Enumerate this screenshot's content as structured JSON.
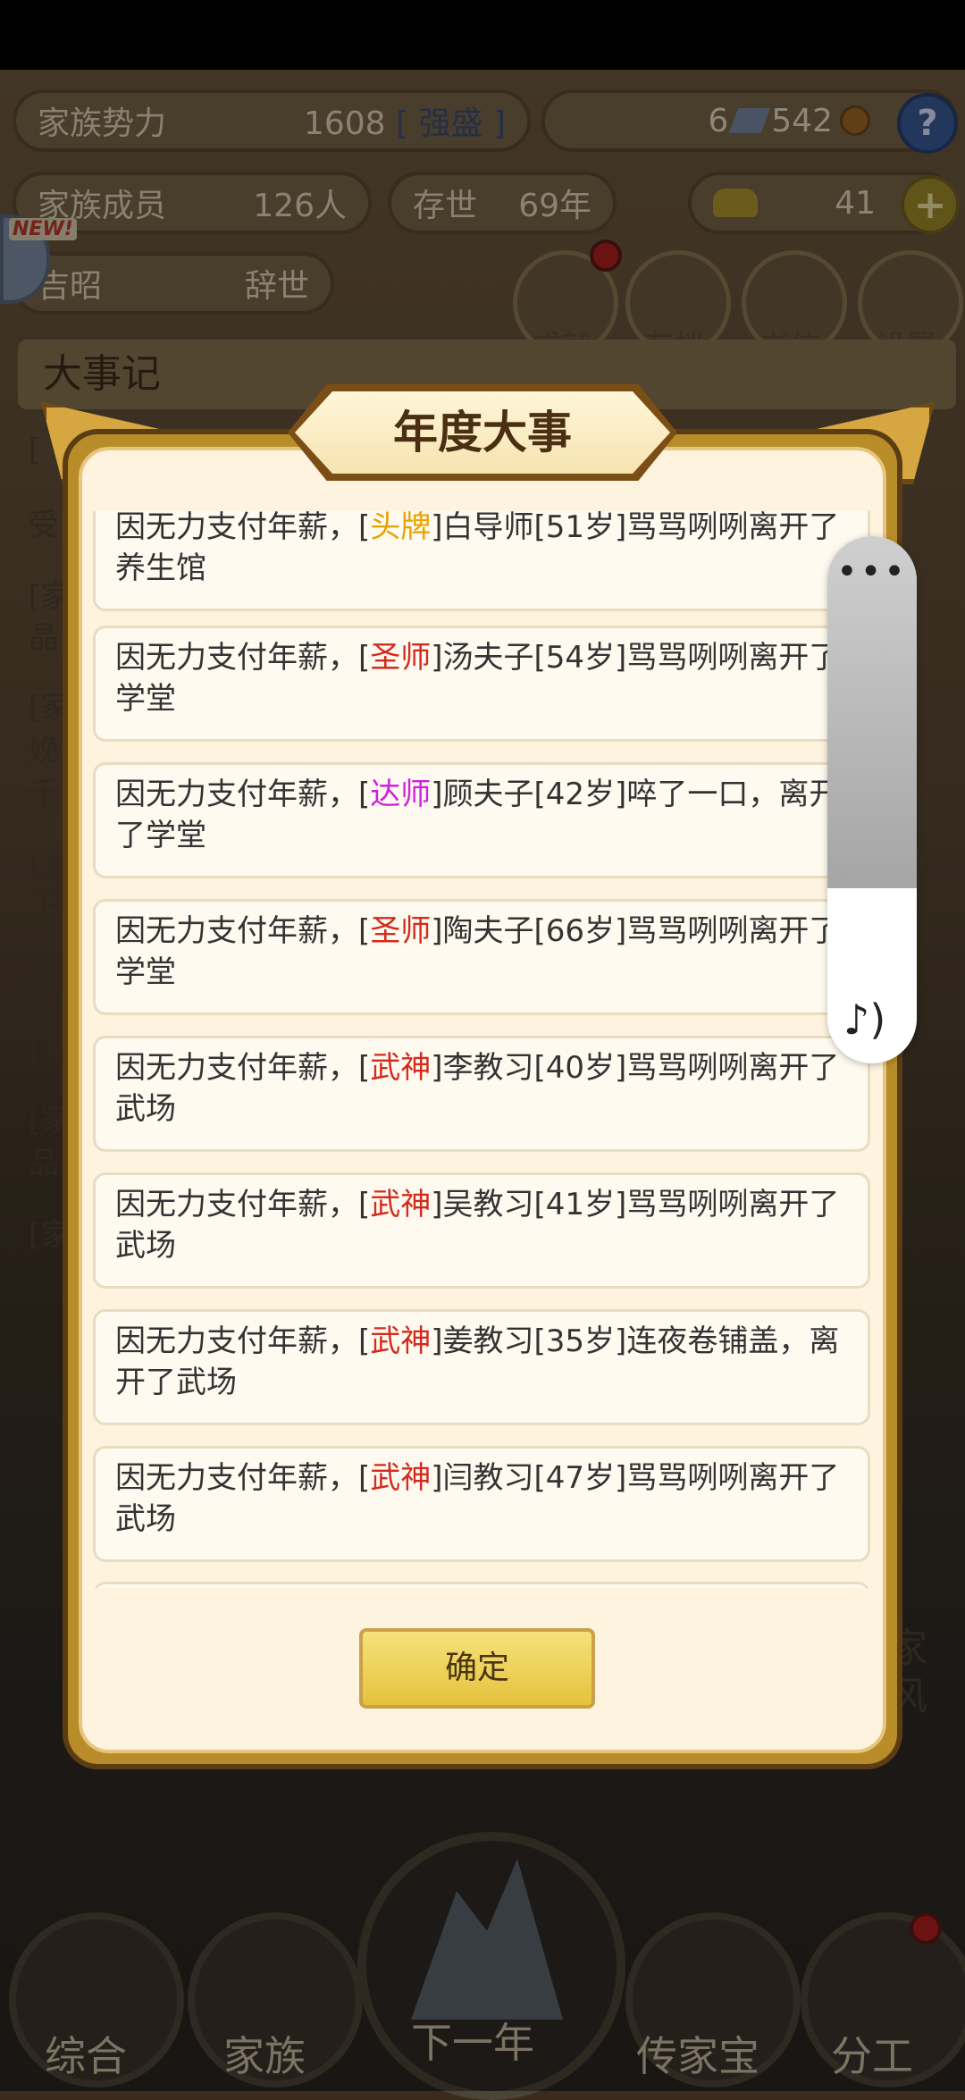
{
  "hud": {
    "family_power_label": "家族势力",
    "family_power_value": "1608",
    "family_power_tag": "[ 强盛 ]",
    "resources_left": "6",
    "resources_right": "542",
    "members_label": "家族成员",
    "members_value": "126人",
    "survive_label": "存世",
    "survive_value": "69年",
    "gold_value": "41",
    "person_name": "吉昭",
    "person_status": "辞世",
    "new_badge": "NEW!",
    "help": "?",
    "plus": "+"
  },
  "round_buttons": [
    "成就",
    "存档",
    "书信",
    "设置"
  ],
  "background_title": "大事记",
  "background_side_chars": [
    "[",
    "受",
    "[家",
    "晶",
    "[家",
    "娩",
    "千",
    "[家",
    "下",
    "[家",
    "[家",
    "[家",
    "品",
    "[家"
  ],
  "dialog": {
    "title": "年度大事",
    "confirm": "确定",
    "items": [
      {
        "prefix": "因无力支付年薪，[",
        "rank": "头牌",
        "rank_color": "#e8a100",
        "rest": "]白导师[51岁]骂骂咧咧离开了养生馆"
      },
      {
        "prefix": "因无力支付年薪，[",
        "rank": "圣师",
        "rank_color": "#d42a1d",
        "rest": "]汤夫子[54岁]骂骂咧咧离开了学堂"
      },
      {
        "prefix": "因无力支付年薪，[",
        "rank": "达师",
        "rank_color": "#d21ee0",
        "rest": "]顾夫子[42岁]啐了一口，离开了学堂"
      },
      {
        "prefix": "因无力支付年薪，[",
        "rank": "圣师",
        "rank_color": "#d42a1d",
        "rest": "]陶夫子[66岁]骂骂咧咧离开了学堂"
      },
      {
        "prefix": "因无力支付年薪，[",
        "rank": "武神",
        "rank_color": "#d42a1d",
        "rest": "]李教习[40岁]骂骂咧咧离开了武场"
      },
      {
        "prefix": "因无力支付年薪，[",
        "rank": "武神",
        "rank_color": "#d42a1d",
        "rest": "]吴教习[41岁]骂骂咧咧离开了武场"
      },
      {
        "prefix": "因无力支付年薪，[",
        "rank": "武神",
        "rank_color": "#d42a1d",
        "rest": "]姜教习[35岁]连夜卷铺盖，离开了武场"
      },
      {
        "prefix": "因无力支付年薪，[",
        "rank": "武神",
        "rank_color": "#d42a1d",
        "rest": "]闫教习[47岁]骂骂咧咧离开了武场"
      }
    ]
  },
  "float_panel": {
    "menu": "•••",
    "note_icon": "♪)"
  },
  "bottom_nav": [
    "综合",
    "家族",
    "下一年",
    "传家宝",
    "分工"
  ],
  "right_side_chars": [
    "家",
    "风"
  ]
}
